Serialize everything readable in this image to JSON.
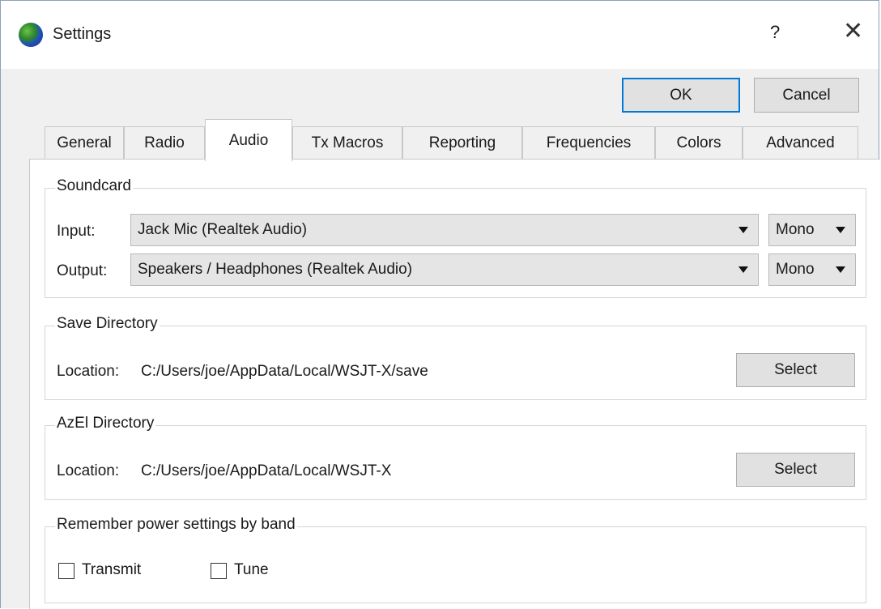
{
  "window": {
    "title": "Settings",
    "help_label": "?",
    "close_label": "✕"
  },
  "buttons": {
    "ok": "OK",
    "cancel": "Cancel"
  },
  "tabs": [
    "General",
    "Radio",
    "Audio",
    "Tx Macros",
    "Reporting",
    "Frequencies",
    "Colors",
    "Advanced"
  ],
  "active_tab": "Audio",
  "soundcard": {
    "title": "Soundcard",
    "input_label": "Input:",
    "input_value": "Jack Mic (Realtek Audio)",
    "input_channel": "Mono",
    "output_label": "Output:",
    "output_value": "Speakers / Headphones (Realtek Audio)",
    "output_channel": "Mono"
  },
  "save_directory": {
    "title": "Save Directory",
    "location_label": "Location:",
    "location_value": "C:/Users/joe/AppData/Local/WSJT-X/save",
    "select_label": "Select"
  },
  "azel_directory": {
    "title": "AzEl Directory",
    "location_label": "Location:",
    "location_value": "C:/Users/joe/AppData/Local/WSJT-X",
    "select_label": "Select"
  },
  "power": {
    "title": "Remember power settings by band",
    "transmit_label": "Transmit",
    "transmit_checked": false,
    "tune_label": "Tune",
    "tune_checked": false
  }
}
